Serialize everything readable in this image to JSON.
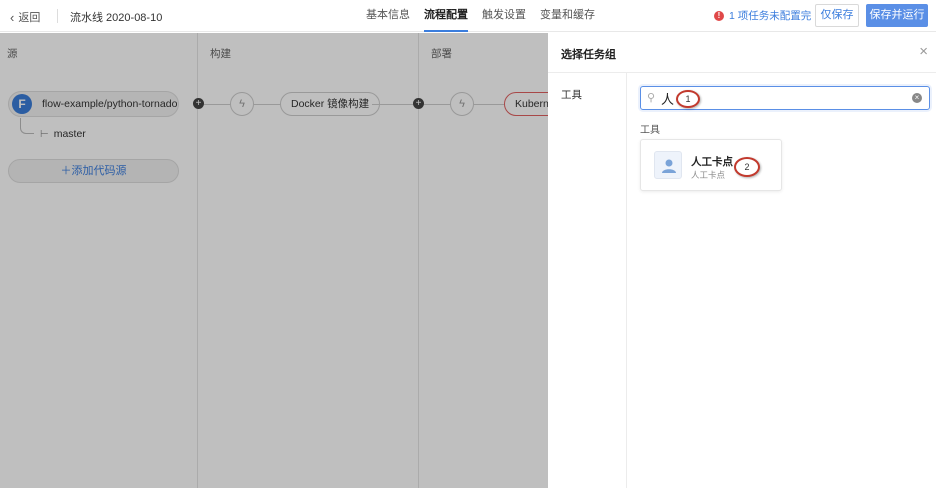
{
  "header": {
    "back_label": "返回",
    "title": "流水线 2020-08-10",
    "tabs": [
      {
        "label": "基本信息"
      },
      {
        "label": "流程配置"
      },
      {
        "label": "触发设置"
      },
      {
        "label": "变量和缓存"
      }
    ],
    "active_tab": "流程配置",
    "warning_icon": "!",
    "warning_text": "1 项任务未配置完",
    "save_label": "仅保存",
    "save_run_label": "保存并运行"
  },
  "pipeline": {
    "columns": [
      {
        "label": "源"
      },
      {
        "label": "构建"
      },
      {
        "label": "部署"
      }
    ],
    "source": {
      "avatar_letter": "F",
      "repo": "flow-example/python-tornado",
      "branch_icon": "⊢",
      "branch": "master",
      "add_source_label": "＋添加代码源"
    },
    "build_job": "Docker 镜像构建",
    "deploy_job": "Kuberne",
    "plus_glyph": "+",
    "bolt_glyph": "ϟ"
  },
  "drawer": {
    "title": "选择任务组",
    "close_glyph": "×",
    "categories": [
      {
        "label": "工具"
      }
    ],
    "search": {
      "value": "人",
      "icon": "⚲",
      "clear_glyph": "×"
    },
    "section_label": "工具",
    "results": [
      {
        "title": "人工卡点",
        "subtitle": "人工卡点",
        "icon": "user-icon"
      }
    ],
    "annotations": [
      "1",
      "2"
    ]
  },
  "colors": {
    "accent": "#3b7ddd",
    "primary_button": "#5a8fe6",
    "warning": "#e04848",
    "annotation_ring": "#c23a2e"
  }
}
